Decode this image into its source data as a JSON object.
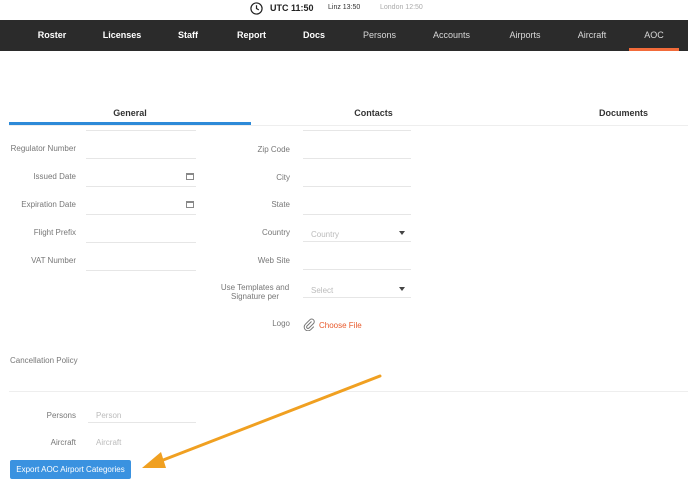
{
  "clock": {
    "utc": "UTC 11:50",
    "linz": "Linz 13:50",
    "london": "London 12:50"
  },
  "nav": {
    "items": [
      {
        "label": "Roster"
      },
      {
        "label": "Licenses"
      },
      {
        "label": "Staff"
      },
      {
        "label": "Report"
      },
      {
        "label": "Docs"
      },
      {
        "label": "Persons"
      },
      {
        "label": "Accounts"
      },
      {
        "label": "Airports"
      },
      {
        "label": "Aircraft"
      },
      {
        "label": "AOC"
      }
    ],
    "active": "AOC"
  },
  "tabs": [
    {
      "label": "General"
    },
    {
      "label": "Contacts"
    },
    {
      "label": "Documents"
    }
  ],
  "left_form": {
    "regulator_number": {
      "label": "Regulator Number"
    },
    "issued_date": {
      "label": "Issued Date"
    },
    "expiration_date": {
      "label": "Expiration Date"
    },
    "flight_prefix": {
      "label": "Flight Prefix"
    },
    "vat_number": {
      "label": "VAT Number"
    }
  },
  "right_form": {
    "zip_code": {
      "label": "Zip Code"
    },
    "city": {
      "label": "City"
    },
    "state": {
      "label": "State"
    },
    "country": {
      "label": "Country",
      "placeholder": "Country"
    },
    "web_site": {
      "label": "Web Site"
    },
    "templates": {
      "label": "Use Templates and Signature per",
      "placeholder": "Select"
    },
    "logo": {
      "label": "Logo",
      "choose": "Choose File"
    }
  },
  "cancellation": {
    "label": "Cancellation Policy"
  },
  "bottom_form": {
    "persons": {
      "label": "Persons",
      "placeholder": "Person"
    },
    "aircraft": {
      "label": "Aircraft",
      "placeholder": "Aircraft"
    }
  },
  "export_button": "Export AOC Airport Categories",
  "colors": {
    "nav_bg": "#2b2b2b",
    "accent": "#f26b3a",
    "tab_active": "#2d8ad8",
    "button": "#3a92e0",
    "annotation_arrow": "#f0a021"
  }
}
